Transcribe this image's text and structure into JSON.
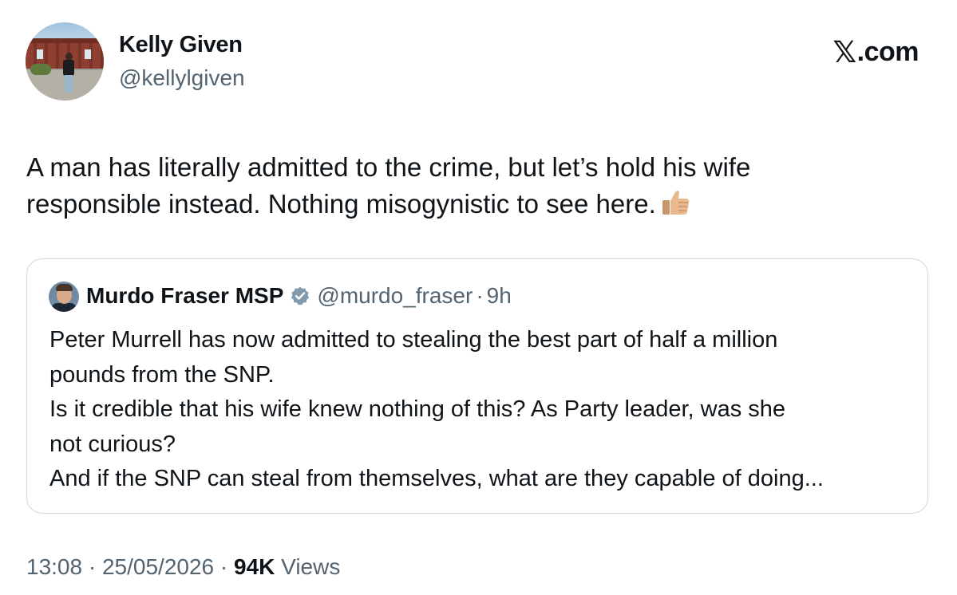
{
  "author": {
    "name": "Kelly Given",
    "handle": "@kellylgiven"
  },
  "brand": {
    "label": ".com",
    "icon": "x-logo-icon"
  },
  "tweet": {
    "lines": [
      "A man has literally admitted to the crime, but let’s hold his wife",
      "responsible instead. Nothing misogynistic to see here."
    ],
    "emoji": "thumbs-up-icon"
  },
  "quoted_tweet": {
    "name": "Murdo Fraser MSP",
    "handle": "@murdo_fraser",
    "separator": "·",
    "time": "9h",
    "verified_icon": "verified-badge-icon",
    "lines": [
      "Peter Murrell has now admitted to stealing the best part of half a million",
      "pounds from the SNP.",
      "Is it credible that his wife knew nothing of this?  As Party leader, was she",
      "not curious?",
      "And if the SNP can steal from themselves, what are they capable of doing..."
    ]
  },
  "meta": {
    "time": "13:08",
    "sep1": "·",
    "date": "25/05/2026",
    "sep2": "·",
    "views_count": "94K",
    "views_label": "Views"
  }
}
